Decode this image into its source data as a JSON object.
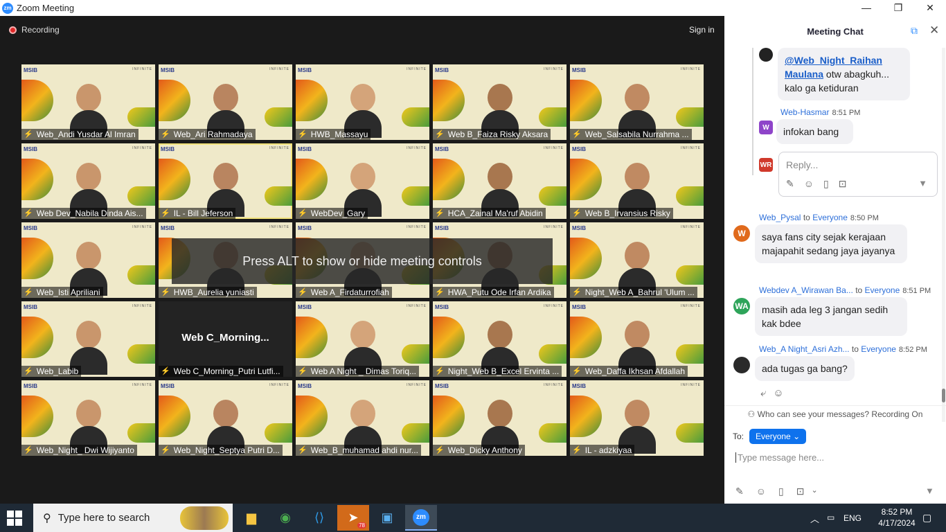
{
  "window": {
    "app_icon": "zm",
    "title": "Zoom Meeting",
    "minimize_icon": "—",
    "maximize_icon": "❐",
    "close_icon": "✕"
  },
  "meeting": {
    "recording_label": "Recording",
    "signin_label": "Sign in",
    "overlay_message": "Press ALT to show or hide meeting controls",
    "banner_left": "MSIB",
    "banner_right": "INFINITE",
    "participants": [
      {
        "name": "Web_Andi Yusdar Al Imran"
      },
      {
        "name": "Web_Ari Rahmadaya"
      },
      {
        "name": "HWB_Massayu"
      },
      {
        "name": "Web B_Faiza Risky Aksara"
      },
      {
        "name": "Web_Salsabila Nurrahma ..."
      },
      {
        "name": "Web Dev_Nabila Dinda Ais..."
      },
      {
        "name": "IL - Bill Jeferson",
        "active": true
      },
      {
        "name": "WebDev_Gary"
      },
      {
        "name": "HCA_Zainal Ma'ruf Abidin"
      },
      {
        "name": "Web B_Irvansius Risky"
      },
      {
        "name": "Web_Isti Apriliani"
      },
      {
        "name": "HWB_Aurelia yuniasti"
      },
      {
        "name": "Web A_Firdaturrofiah"
      },
      {
        "name": "HWA_Putu Ode Irfan Ardika"
      },
      {
        "name": "Night_Web A_Bahrul 'Ulum ..."
      },
      {
        "name": "Web_Labib"
      },
      {
        "name": "Web C_Morning_Putri Lutfi...",
        "video_off": true,
        "display_name": "Web  C_Morning..."
      },
      {
        "name": "Web A Night _ Dimas Toriq..."
      },
      {
        "name": "Night_Web B_Excel Ervinta ..."
      },
      {
        "name": "Web_Daffa Ikhsan Afdallah"
      },
      {
        "name": "Web_Night_ Dwi Wijiyanto"
      },
      {
        "name": "Web_Night_Septya Putri D..."
      },
      {
        "name": "Web_B_muhamad ahdi nur..."
      },
      {
        "name": "Web_Dicky Anthony"
      },
      {
        "name": "IL - adzkiyaa"
      }
    ]
  },
  "chat": {
    "title": "Meeting Chat",
    "messages": {
      "m1": {
        "mention": "@Web_Night_Raihan Maulana",
        "text": " otw abagkuh... kalo ga ketiduran"
      },
      "m2": {
        "sender": "Web-Hasmar",
        "time": "8:51 PM",
        "avatar": "W",
        "avatar_color": "#8e44c9",
        "text": "infokan bang"
      },
      "reply": {
        "avatar": "WR",
        "avatar_color": "#d0392b",
        "placeholder": "Reply..."
      },
      "m3": {
        "sender": "Web_Pysal",
        "to": "to",
        "recipient": "Everyone",
        "time": "8:50 PM",
        "avatar": "W",
        "avatar_color": "#e06a1c",
        "text": "saya fans city sejak kerajaan majapahit sedang jaya jayanya"
      },
      "m4": {
        "sender": "Webdev A_Wirawan Ba...",
        "to": "to",
        "recipient": "Everyone",
        "time": "8:51 PM",
        "avatar": "WA",
        "avatar_color": "#2ea45a",
        "text": "masih ada leg 3 jangan sedih kak bdee"
      },
      "m5": {
        "sender": "Web_A Night_Asri Azh...",
        "to": "to",
        "recipient": "Everyone",
        "time": "8:52 PM",
        "text": "ada tugas ga bang?"
      }
    },
    "privacy_notice": "Who can see your messages? Recording On",
    "to_label": "To:",
    "to_value": "Everyone",
    "input_placeholder": "Type message here..."
  },
  "taskbar": {
    "search_placeholder": "Type here to search",
    "telegram_badge": "78",
    "language": "ENG",
    "time": "8:52 PM",
    "date": "4/17/2024"
  },
  "colors": {
    "accent": "#0e72ed",
    "recording": "#e02828",
    "active_speaker": "#f2e27a"
  }
}
